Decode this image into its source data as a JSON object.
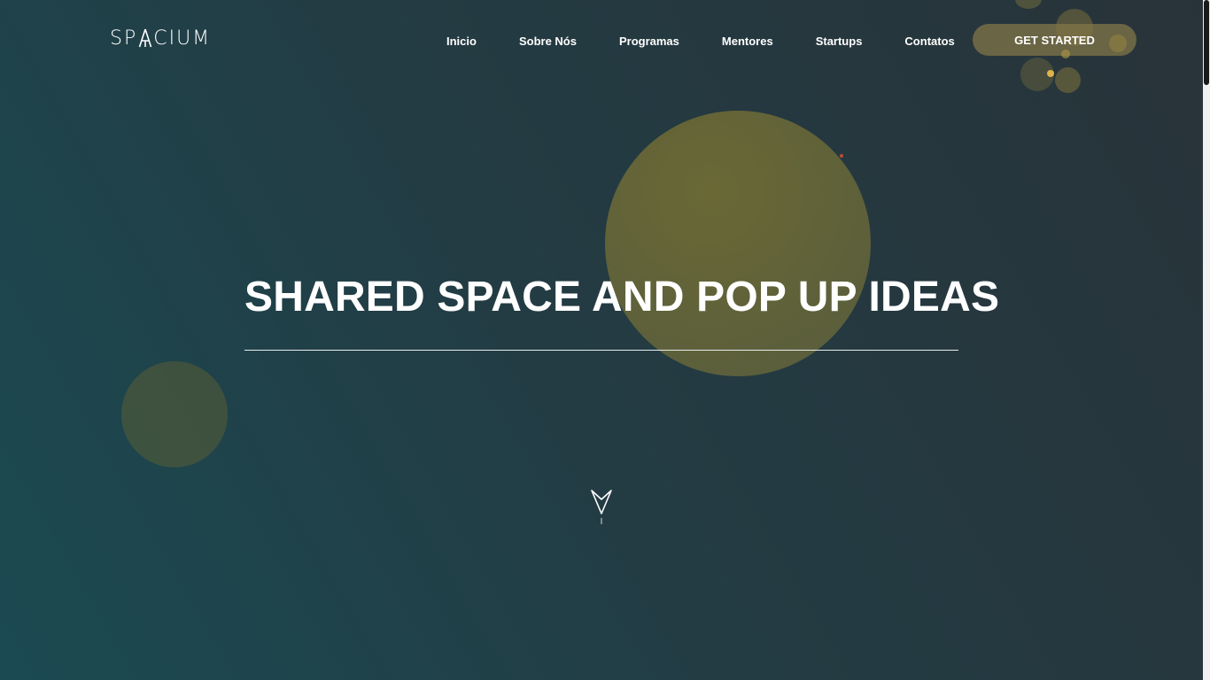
{
  "header": {
    "logo_text_left": "SP",
    "logo_text_right": "CIUM",
    "nav": [
      {
        "label": "Inicio"
      },
      {
        "label": "Sobre Nós"
      },
      {
        "label": "Programas"
      },
      {
        "label": "Mentores"
      },
      {
        "label": "Startups"
      },
      {
        "label": "Contatos"
      }
    ],
    "cta_label": "GET STARTED"
  },
  "hero": {
    "title": "SHARED SPACE AND POP UP IDEAS",
    "scroll_icon": "arrow-down-icon"
  },
  "colors": {
    "accent": "#e0b24a",
    "bubble": "#6f6c34",
    "background_start": "#1b4a52",
    "background_end": "#283339",
    "text": "#ffffff"
  },
  "icons": {
    "logo": "rocket-a-icon",
    "scroll": "paper-plane-arrow-icon"
  }
}
